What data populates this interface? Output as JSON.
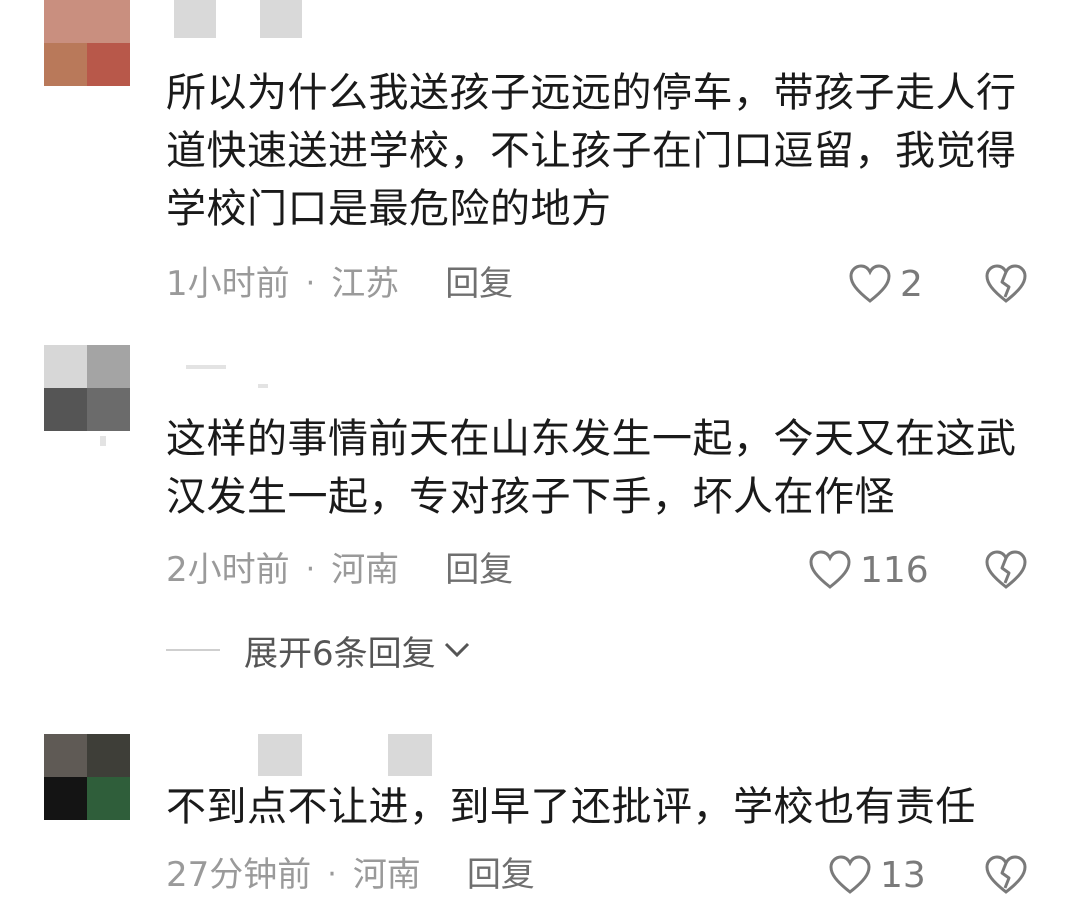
{
  "comments": [
    {
      "text": "所以为什么我送孩子远远的停车，带孩子走人行道快速送进学校，不让孩子在门口逗留，我觉得学校门口是最危险的地方",
      "time": "1小时前",
      "location": "江苏",
      "reply_label": "回复",
      "likes": "2"
    },
    {
      "text": "这样的事情前天在山东发生一起，今天又在这武汉发生一起，专对孩子下手，坏人在作怪",
      "time": "2小时前",
      "location": "河南",
      "reply_label": "回复",
      "likes": "116",
      "expand_label": "展开6条回复"
    },
    {
      "text": "不到点不让进，到早了还批评，学校也有责任",
      "time": "27分钟前",
      "location": "河南",
      "reply_label": "回复",
      "likes": "13"
    }
  ],
  "separator": "·",
  "icons": {
    "like": "heart-outline-icon",
    "dislike": "broken-heart-icon",
    "expand": "chevron-down-icon"
  },
  "colors": {
    "text": "#1a1a1a",
    "meta": "#9a9a9a",
    "reply": "#6f6f6f"
  }
}
